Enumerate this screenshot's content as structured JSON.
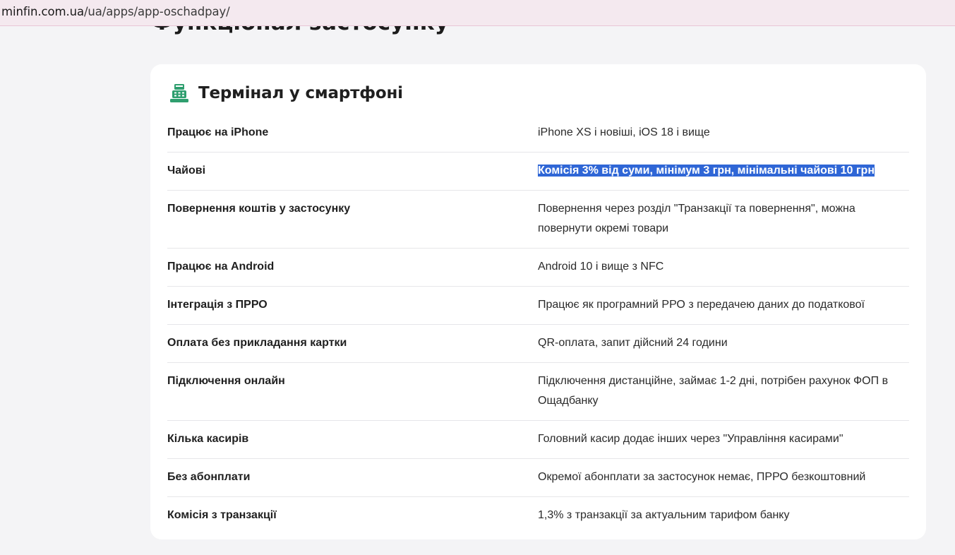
{
  "browser": {
    "url_host": "minfin.com.ua",
    "url_path": "/ua/apps/app-oschadpay/"
  },
  "page": {
    "section_heading": "Функціонал застосунку"
  },
  "card": {
    "icon": "cash-register-icon",
    "title": "Термінал у смартфоні",
    "rows": [
      {
        "label": "Працює на iPhone",
        "value": "iPhone XS і новіші, iOS 18 і вище"
      },
      {
        "label": "Чайові",
        "value": "Комісія 3% від суми, мінімум 3 грн, мінімальні чайові 10 грн"
      },
      {
        "label": "Повернення коштів у застосунку",
        "value": "Повернення через розділ \"Транзакції та повернення\", можна повернути окремі товари"
      },
      {
        "label": "Працює на Android",
        "value": "Android 10 і вище з NFC"
      },
      {
        "label": "Інтеграція з ПРРО",
        "value": "Працює як програмний РРО з передачею даних до податкової"
      },
      {
        "label": "Оплата без прикладання картки",
        "value": "QR-оплата, запит дійсний 24 години"
      },
      {
        "label": "Підключення онлайн",
        "value": "Підключення дистанційне, займає 1-2 дні, потрібен рахунок ФОП в Ощадбанку"
      },
      {
        "label": "Кілька касирів",
        "value": "Головний касир додає інших через \"Управління касирами\""
      },
      {
        "label": "Без абонплати",
        "value": "Окремої абонплати за застосунок немає, ПРРО безкоштовний"
      },
      {
        "label": "Комісія з транзакції",
        "value": "1,3% з транзакції за актуальним тарифом банку"
      }
    ]
  },
  "colors": {
    "accent_icon": "#2e9e6e",
    "selection": "#2f66d6",
    "urlbar": "#f4e9ef"
  }
}
